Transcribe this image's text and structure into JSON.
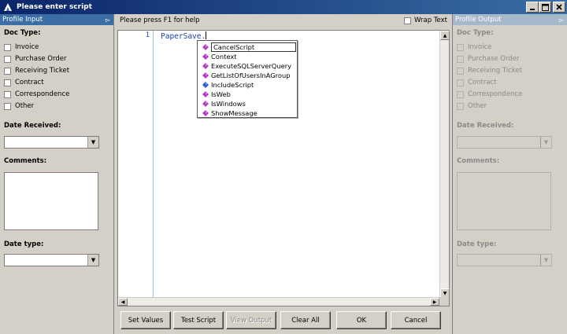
{
  "window": {
    "title": "Please enter script"
  },
  "left_panel": {
    "header": "Profile Input",
    "doc_type_label": "Doc Type:",
    "doc_types": [
      "Invoice",
      "Purchase Order",
      "Receiving Ticket",
      "Contract",
      "Correspondence",
      "Other"
    ],
    "date_received_label": "Date Received:",
    "date_received_value": "",
    "comments_label": "Comments:",
    "comments_value": "",
    "date_type_label": "Date type:",
    "date_type_value": ""
  },
  "right_panel": {
    "header": "Profile Output",
    "doc_type_label": "Doc Type:",
    "doc_types": [
      "Invoice",
      "Purchase Order",
      "Receiving Ticket",
      "Contract",
      "Correspondence",
      "Other"
    ],
    "date_received_label": "Date Received:",
    "comments_label": "Comments:",
    "date_type_label": "Date type:"
  },
  "editor": {
    "help_text": "Please press F1 for help",
    "wrap_text_label": "Wrap Text",
    "wrap_text_checked": false,
    "line_number": "1",
    "code_line": "PaperSave."
  },
  "autocomplete": {
    "items": [
      {
        "label": "CancelScript",
        "icon": "method-icon",
        "selected": true
      },
      {
        "label": "Context",
        "icon": "property-icon"
      },
      {
        "label": "ExecuteSQLServerQuery",
        "icon": "method-icon"
      },
      {
        "label": "GetListOfUsersInAGroup",
        "icon": "method-icon"
      },
      {
        "label": "IncludeScript",
        "icon": "include-icon"
      },
      {
        "label": "IsWeb",
        "icon": "method-icon"
      },
      {
        "label": "IsWindows",
        "icon": "method-icon"
      },
      {
        "label": "ShowMessage",
        "icon": "method-icon"
      }
    ]
  },
  "buttons": {
    "set_values": "Set Values",
    "test_script": "Test Script",
    "view_output": "View Output",
    "clear_all": "Clear All",
    "ok": "OK",
    "cancel": "Cancel"
  },
  "colors": {
    "titlebar_start": "#0a246a",
    "titlebar_end": "#3a6ea5",
    "active_panel_header": "#3a6ea5",
    "inactive_panel_header": "#a6b8cc",
    "code_blue": "#1a3ea8",
    "method_purple": "#b040c0",
    "include_blue": "#2a5bd8"
  }
}
